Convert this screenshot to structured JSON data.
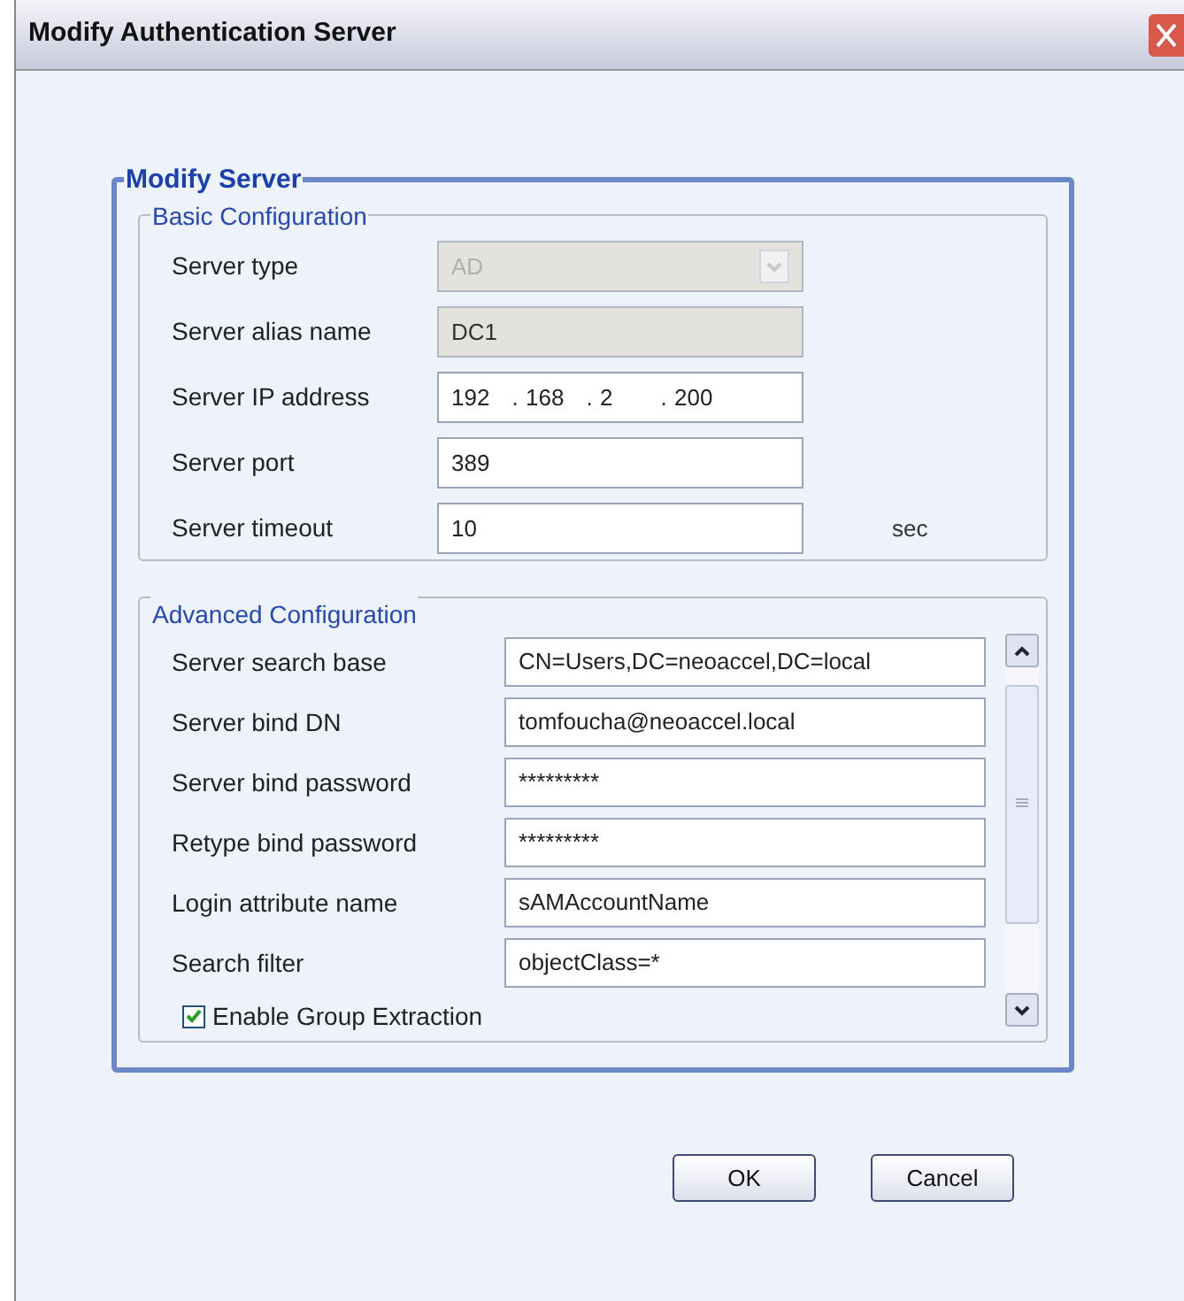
{
  "window": {
    "title": "Modify Authentication Server"
  },
  "group": {
    "title": "Modify Server"
  },
  "basic": {
    "title": "Basic Configuration",
    "rows": [
      {
        "label": "Server type",
        "kind": "dropdown",
        "value": "AD",
        "disabled": true
      },
      {
        "label": "Server alias name",
        "kind": "text",
        "value": "DC1",
        "disabled": true
      },
      {
        "label": "Server IP address",
        "kind": "ip",
        "octets": [
          "192",
          "168",
          "2",
          "200"
        ],
        "separator": ".",
        "disabled": false
      },
      {
        "label": "Server port",
        "kind": "text",
        "value": "389",
        "disabled": false
      },
      {
        "label": "Server timeout",
        "kind": "text",
        "value": "10",
        "disabled": false,
        "unit": "sec"
      }
    ]
  },
  "advanced": {
    "title": "Advanced Configuration",
    "rows": [
      {
        "label": "Server search base",
        "kind": "text",
        "value": "CN=Users,DC=neoaccel,DC=local"
      },
      {
        "label": "Server bind DN",
        "kind": "text",
        "value": "tomfoucha@neoaccel.local"
      },
      {
        "label": "Server bind password",
        "kind": "text",
        "value": "*********"
      },
      {
        "label": "Retype bind password",
        "kind": "text",
        "value": "*********"
      },
      {
        "label": "Login attribute name",
        "kind": "text",
        "value": "sAMAccountName"
      },
      {
        "label": "Search filter",
        "kind": "text",
        "value": "objectClass=*"
      },
      {
        "label": "Enable Group Extraction",
        "kind": "checkbox",
        "checked": true
      }
    ]
  },
  "buttons": [
    "OK",
    "Cancel"
  ]
}
